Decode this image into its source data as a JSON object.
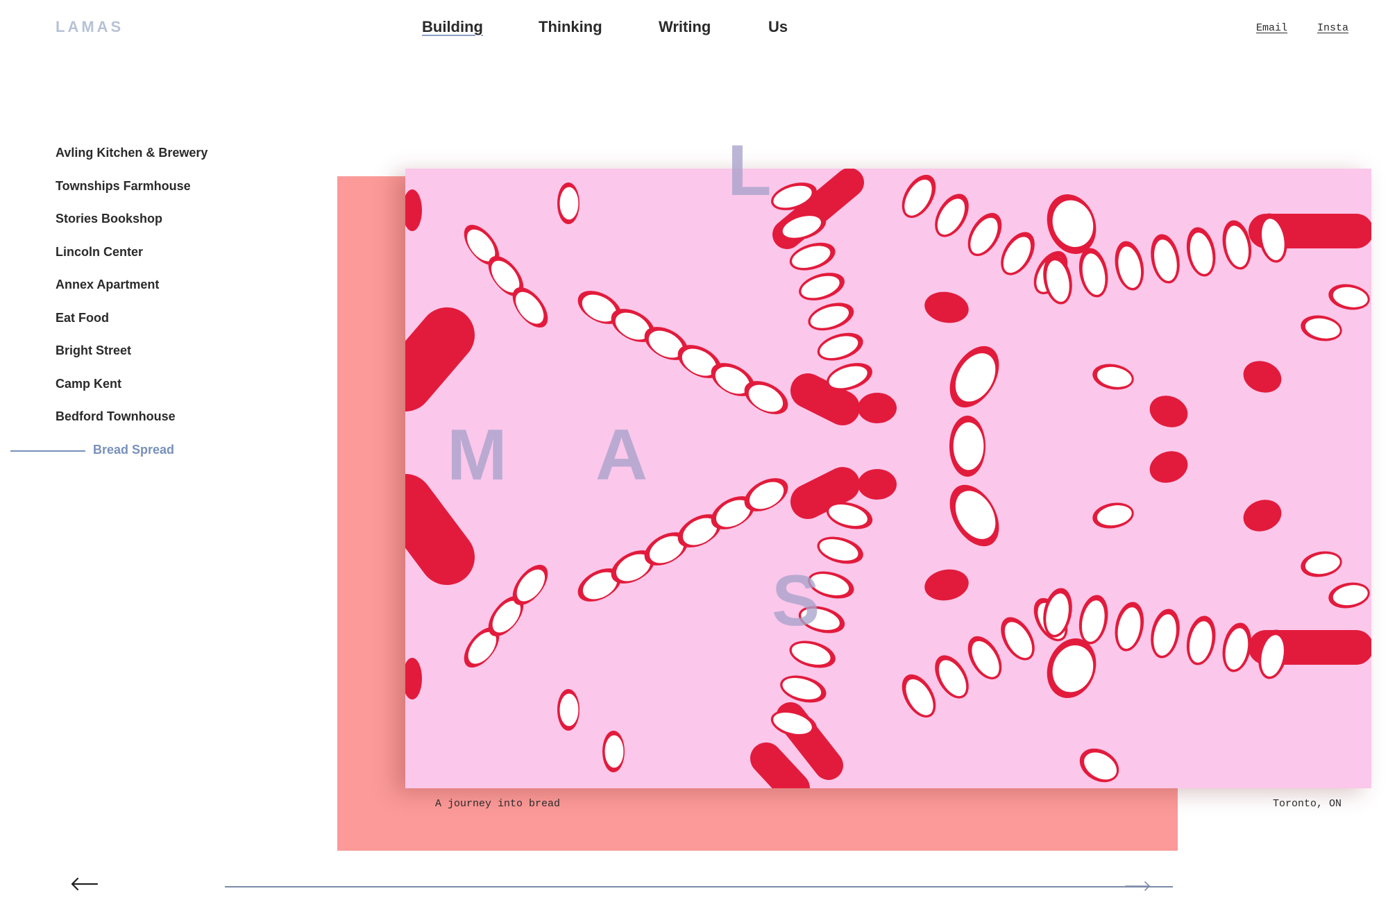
{
  "brand": {
    "logo": "LAMAS"
  },
  "nav": {
    "items": [
      {
        "label": "Building",
        "active": true
      },
      {
        "label": "Thinking",
        "active": false
      },
      {
        "label": "Writing",
        "active": false
      },
      {
        "label": "Us",
        "active": false
      }
    ]
  },
  "utility": {
    "email": "Email",
    "insta": "Insta"
  },
  "projects": [
    "Avling Kitchen & Brewery",
    "Townships Farmhouse",
    "Stories Bookshop",
    "Lincoln Center",
    "Annex Apartment",
    "Eat Food",
    "Bright Street",
    "Camp Kent",
    "Bedford Townhouse",
    "Bread Spread"
  ],
  "active_project": "Bread Spread",
  "hero": {
    "overlay_letters": {
      "l": "L",
      "m": "M",
      "a": "A",
      "s": "S"
    },
    "colors": {
      "background": "#fbc7ea",
      "radish": "#e21b3c",
      "flesh": "#ffffff",
      "backdrop": "#fb9a98"
    }
  },
  "caption": {
    "description": "A journey into bread",
    "location": "Toronto, ON"
  },
  "pager": {
    "prev_icon": "arrow-left-icon",
    "next_icon": "arrow-right-icon",
    "progress": 0.95
  }
}
